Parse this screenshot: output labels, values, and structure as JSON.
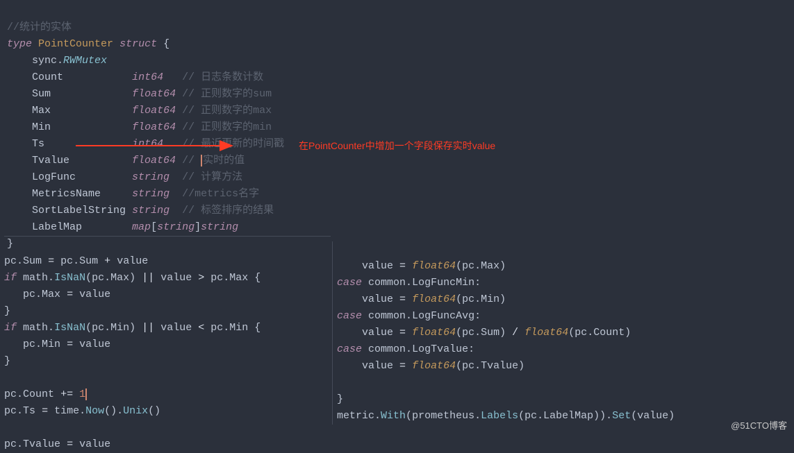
{
  "top": {
    "l1": "//统计的实体",
    "l2a": "type",
    "l2b": "PointCounter",
    "l2c": "struct",
    "l3a": "sync",
    "l3b": "RWMutex",
    "f1": {
      "name": "Count",
      "type": "int64",
      "comment": "// 日志条数计数"
    },
    "f2": {
      "name": "Sum",
      "type": "float64",
      "comment": "// 正则数字的sum"
    },
    "f3": {
      "name": "Max",
      "type": "float64",
      "comment": "// 正则数字的max"
    },
    "f4": {
      "name": "Min",
      "type": "float64",
      "comment": "// 正则数字的min"
    },
    "f5": {
      "name": "Ts",
      "type": "int64",
      "comment": "// 最近更新的时间戳"
    },
    "f6": {
      "name": "Tvalue",
      "type": "float64",
      "comment": "实时的值"
    },
    "f7": {
      "name": "LogFunc",
      "type": "string",
      "comment": "// 计算方法"
    },
    "f8": {
      "name": "MetricsName",
      "type": "string",
      "comment": "//metrics名字"
    },
    "f9": {
      "name": "SortLabelString",
      "type": "string",
      "comment": "// 标签排序的结果"
    },
    "f10": {
      "name": "LabelMap",
      "type_outer": "map",
      "type_k": "string",
      "type_v": "string"
    }
  },
  "annot": "在PointCounter中增加一个字段保存实时value",
  "left": {
    "a1": "pc",
    "a2": "Sum",
    "a3": "pc",
    "a4": "Sum",
    "a5": "value",
    "b1": "if",
    "b2": "math",
    "b3": "IsNaN",
    "b4": "pc",
    "b5": "Max",
    "b6": "value",
    "b7": "pc",
    "b8": "Max",
    "c1": "pc",
    "c2": "Max",
    "c3": "value",
    "d1": "if",
    "d2": "math",
    "d3": "IsNaN",
    "d4": "pc",
    "d5": "Min",
    "d6": "value",
    "d7": "pc",
    "d8": "Min",
    "e1": "pc",
    "e2": "Min",
    "e3": "value",
    "g1": "pc",
    "g2": "Count",
    "g3": "1",
    "h1": "pc",
    "h2": "Ts",
    "h3": "time",
    "h4": "Now",
    "h5": "Unix",
    "i1": "pc",
    "i2": "Tvalue",
    "i3": "value"
  },
  "right": {
    "r0a": "value",
    "r0b": "float64",
    "r0c": "pc",
    "r0d": "Max",
    "r1a": "case",
    "r1b": "common",
    "r1c": "LogFuncMin",
    "r2a": "value",
    "r2b": "float64",
    "r2c": "pc",
    "r2d": "Min",
    "r3a": "case",
    "r3b": "common",
    "r3c": "LogFuncAvg",
    "r4a": "value",
    "r4b": "float64",
    "r4c": "pc",
    "r4d": "Sum",
    "r4e": "float64",
    "r4f": "pc",
    "r4g": "Count",
    "r5a": "case",
    "r5b": "common",
    "r5c": "LogTvalue",
    "r6a": "value",
    "r6b": "float64",
    "r6c": "pc",
    "r6d": "Tvalue",
    "r8a": "metric",
    "r8b": "With",
    "r8c": "prometheus",
    "r8d": "Labels",
    "r8e": "pc",
    "r8f": "LabelMap",
    "r8g": "Set",
    "r8h": "value"
  },
  "watermark": "@51CTO博客"
}
